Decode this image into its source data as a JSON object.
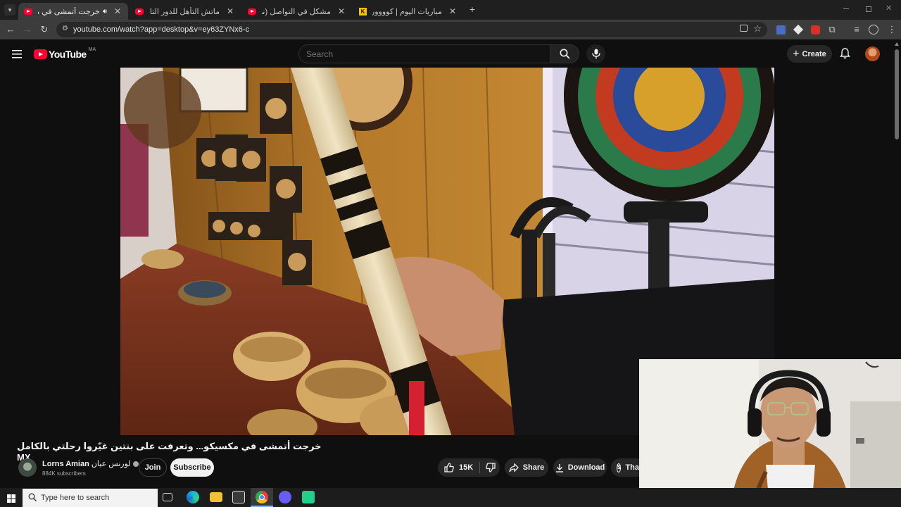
{
  "browser": {
    "tabs": [
      {
        "title": "خرجت أتمشى في مكسيكو...",
        "active": true
      },
      {
        "title": "ماتش التأهل للدور التاني؟ التشكـ",
        "active": false
      },
      {
        "title": "مشكل في التواصل (نظرية الزواج)",
        "active": false
      },
      {
        "title": "مباريات اليوم | كوووورة",
        "active": false
      }
    ],
    "new_tab_label": "+",
    "url": "youtube.com/watch?app=desktop&v=ey63ZYNx6-c"
  },
  "youtube": {
    "logo_text": "YouTube",
    "region": "MA",
    "search_placeholder": "Search",
    "create_label": "Create",
    "video_title": "خرجت أتمشى في مكسيكو... وتعرفت على بنتين غيّروا رحلتي بالكامل MX",
    "channel": {
      "name": "Lorns Amian",
      "name_ar": "لورنس عيان",
      "subscribers": "884K subscribers"
    },
    "join_label": "Join",
    "subscribe_label": "Subscribe",
    "likes": "15K",
    "share_label": "Share",
    "download_label": "Download",
    "thanks_label": "Tha"
  },
  "taskbar": {
    "search_placeholder": "Type here to search"
  },
  "colors": {
    "yt_red": "#ff0033",
    "background": "#0f0f0f",
    "pill": "#272727"
  }
}
